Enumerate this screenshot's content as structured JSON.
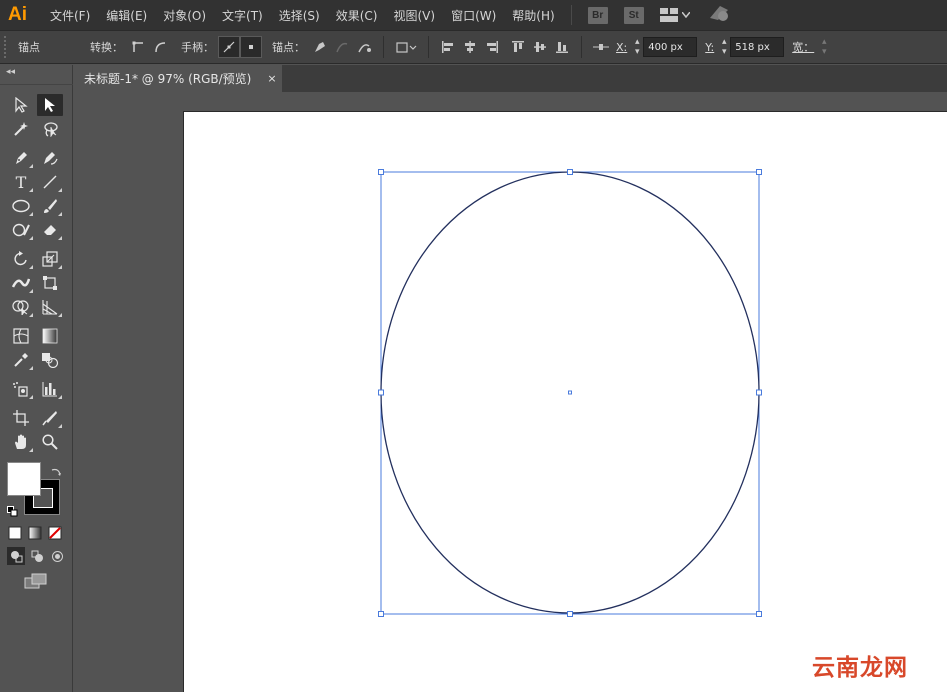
{
  "app": {
    "logo": "Ai"
  },
  "menu": [
    "文件(F)",
    "编辑(E)",
    "对象(O)",
    "文字(T)",
    "选择(S)",
    "效果(C)",
    "视图(V)",
    "窗口(W)",
    "帮助(H)"
  ],
  "bridge": {
    "br": "Br",
    "st": "St"
  },
  "control": {
    "anchor_label": "锚点",
    "convert_label": "转换：",
    "handles_label": "手柄：",
    "anchors_label": "锚点：",
    "x_label": "X:",
    "x_value": "400 px",
    "y_label": "Y:",
    "y_value": "518 px",
    "w_label": "宽："
  },
  "document": {
    "tab_title": "未标题-1* @ 97% (RGB/预览)",
    "close": "×"
  },
  "watermark": "云南龙网"
}
